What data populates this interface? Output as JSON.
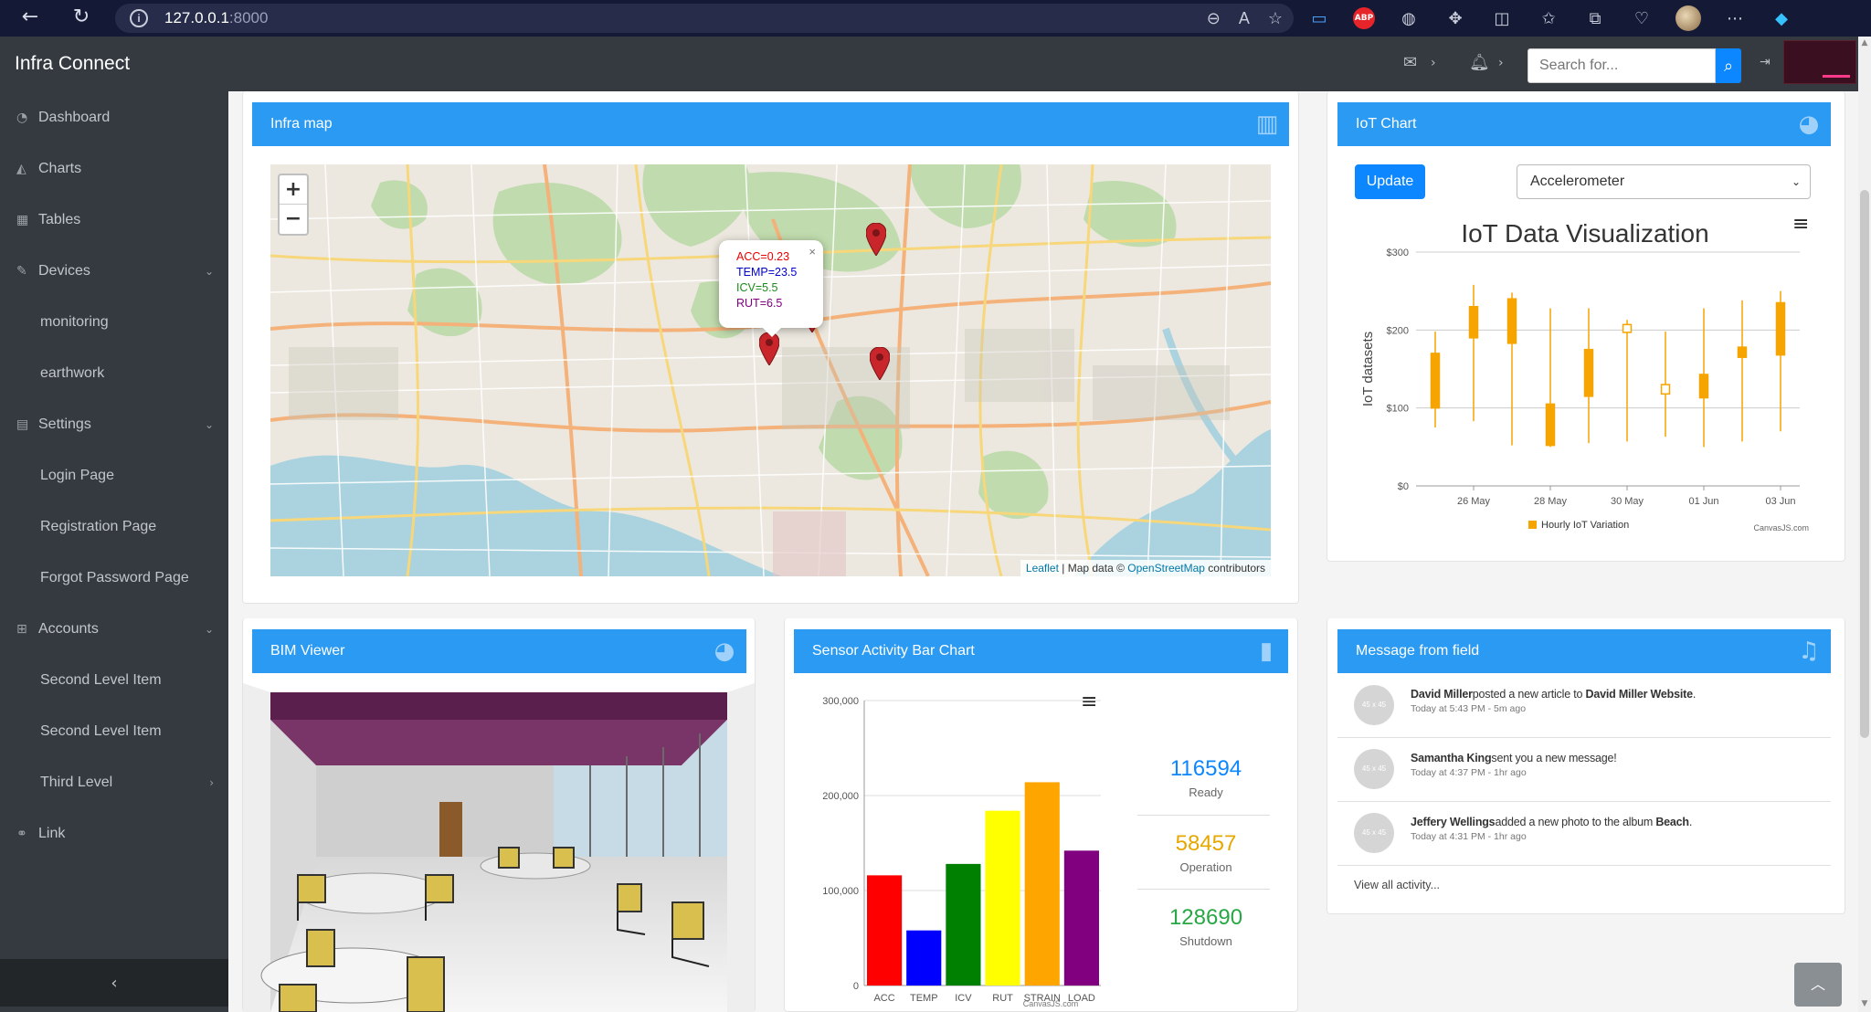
{
  "browser": {
    "url_host": "127.0.0.1",
    "url_port": ":8000"
  },
  "header": {
    "brand": "Infra Connect",
    "search_placeholder": "Search for..."
  },
  "sidebar": {
    "items": [
      {
        "label": "Dashboard",
        "icon": "tachometer-icon"
      },
      {
        "label": "Charts",
        "icon": "area-chart-icon"
      },
      {
        "label": "Tables",
        "icon": "table-icon"
      },
      {
        "label": "Devices",
        "icon": "wrench-icon"
      },
      {
        "label": "monitoring"
      },
      {
        "label": "earthwork"
      },
      {
        "label": "Settings",
        "icon": "file-icon"
      },
      {
        "label": "Login Page"
      },
      {
        "label": "Registration Page"
      },
      {
        "label": "Forgot Password Page"
      },
      {
        "label": "Accounts",
        "icon": "sitemap-icon"
      },
      {
        "label": "Second Level Item"
      },
      {
        "label": "Second Level Item"
      },
      {
        "label": "Third Level"
      },
      {
        "label": "Link",
        "icon": "link-icon"
      }
    ],
    "toggle": "‹"
  },
  "infra_map": {
    "title": "Infra map",
    "popup": {
      "acc": "ACC=0.23",
      "temp": "TEMP=23.5",
      "icv": "ICV=5.5",
      "rut": "RUT=6.5"
    },
    "attribution": {
      "leaflet": "Leaflet",
      "sep": " | Map data © ",
      "osm": "OpenStreetMap",
      "suffix": " contributors"
    },
    "zoom_in": "+",
    "zoom_out": "−"
  },
  "iot_chart": {
    "title": "IoT Chart",
    "update_label": "Update",
    "selected_sensor": "Accelerometer"
  },
  "bim_viewer": {
    "title": "BIM Viewer"
  },
  "sensor_bar": {
    "title": "Sensor Activity Bar Chart",
    "stats": [
      {
        "value": "116594",
        "label": "Ready",
        "color": "#0d87ff"
      },
      {
        "value": "58457",
        "label": "Operation",
        "color": "#e6a800"
      },
      {
        "value": "128690",
        "label": "Shutdown",
        "color": "#28a745"
      }
    ]
  },
  "messages": {
    "title": "Message from field",
    "items": [
      {
        "avatar": "45 x 45",
        "name": "David Miller",
        "action": "posted a new article to ",
        "target": "David Miller Website",
        "suffix": ".",
        "time": "Today at 5:43 PM - 5m ago"
      },
      {
        "avatar": "45 x 45",
        "name": "Samantha King",
        "action": "sent you a new message!",
        "target": "",
        "suffix": "",
        "time": "Today at 4:37 PM - 1hr ago"
      },
      {
        "avatar": "45 x 45",
        "name": "Jeffery Wellings",
        "action": "added a new photo to the album ",
        "target": "Beach",
        "suffix": ".",
        "time": "Today at 4:31 PM - 1hr ago"
      }
    ],
    "view_all": "View all activity..."
  },
  "chart_data": [
    {
      "type": "candlestick",
      "title": "IoT Data Visualization",
      "ylabel": "IoT datasets",
      "xlabel": "",
      "ylim": [
        0,
        300
      ],
      "yticks": [
        "$0",
        "$100",
        "$200",
        "$300"
      ],
      "xticks": [
        "26 May",
        "28 May",
        "30 May",
        "01 Jun",
        "03 Jun"
      ],
      "legend": "Hourly IoT Variation",
      "legend_position": "bottom",
      "credit": "CanvasJS.com",
      "color": "#f5a400",
      "candles": [
        {
          "x": "25 May",
          "open": 170,
          "high": 198,
          "low": 75,
          "close": 100
        },
        {
          "x": "26 May",
          "open": 230,
          "high": 258,
          "low": 83,
          "close": 190
        },
        {
          "x": "27 May",
          "open": 240,
          "high": 248,
          "low": 52,
          "close": 183
        },
        {
          "x": "28 May",
          "open": 105,
          "high": 228,
          "low": 50,
          "close": 52
        },
        {
          "x": "29 May",
          "open": 175,
          "high": 228,
          "low": 55,
          "close": 115
        },
        {
          "x": "30 May",
          "open": 197,
          "high": 213,
          "low": 57,
          "close": 207
        },
        {
          "x": "31 May",
          "open": 118,
          "high": 198,
          "low": 63,
          "close": 130
        },
        {
          "x": "01 Jun",
          "open": 143,
          "high": 228,
          "low": 50,
          "close": 113
        },
        {
          "x": "02 Jun",
          "open": 178,
          "high": 238,
          "low": 57,
          "close": 165
        },
        {
          "x": "03 Jun",
          "open": 235,
          "high": 250,
          "low": 70,
          "close": 168
        }
      ]
    },
    {
      "type": "bar",
      "title": "",
      "categories": [
        "ACC",
        "TEMP",
        "ICV",
        "RUT",
        "STRAIN",
        "LOAD"
      ],
      "values": [
        116000,
        58000,
        128000,
        184000,
        214000,
        142000
      ],
      "colors": [
        "#ff0000",
        "#0000ff",
        "#008000",
        "#ffff00",
        "#ffa500",
        "#800080"
      ],
      "ylim": [
        0,
        300000
      ],
      "yticks": [
        "0",
        "100,000",
        "200,000",
        "300,000"
      ],
      "credit": "CanvasJS.com"
    }
  ]
}
